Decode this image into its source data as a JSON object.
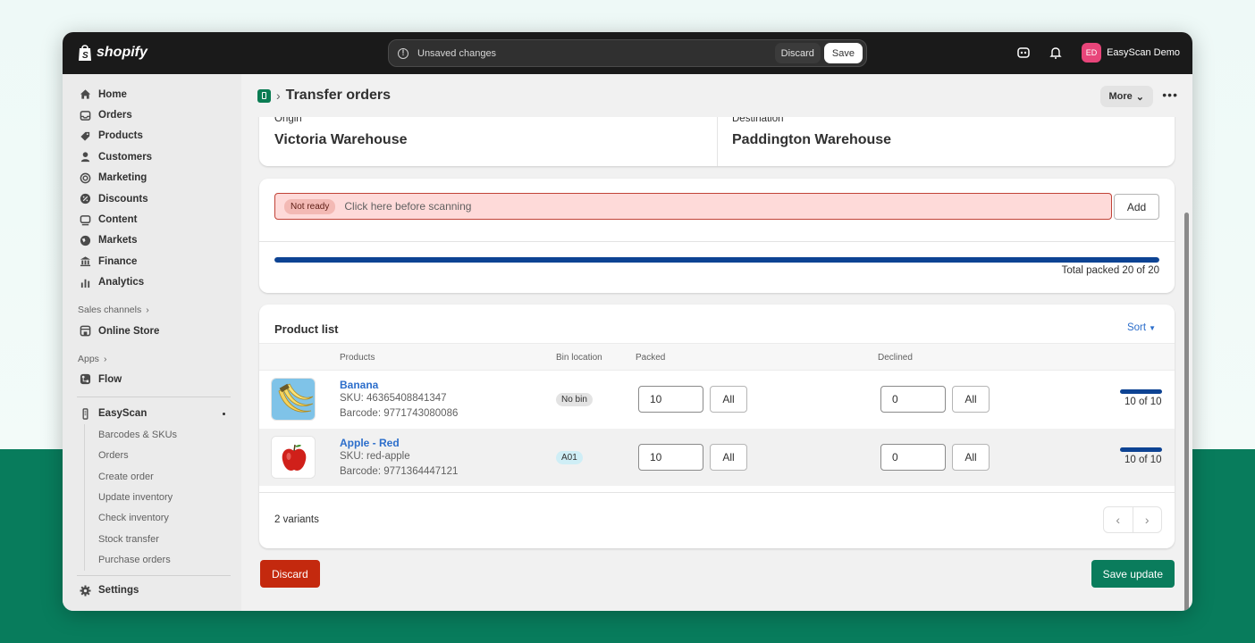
{
  "topbar": {
    "brand": "shopify",
    "unsaved_message": "Unsaved changes",
    "discard_label": "Discard",
    "save_label": "Save",
    "user_initials": "ED",
    "user_name": "EasyScan Demo"
  },
  "sidebar": {
    "items": [
      {
        "label": "Home",
        "icon": "home-icon"
      },
      {
        "label": "Orders",
        "icon": "inbox-icon"
      },
      {
        "label": "Products",
        "icon": "tag-icon"
      },
      {
        "label": "Customers",
        "icon": "person-icon"
      },
      {
        "label": "Marketing",
        "icon": "target-icon"
      },
      {
        "label": "Discounts",
        "icon": "discount-icon"
      },
      {
        "label": "Content",
        "icon": "content-icon"
      },
      {
        "label": "Markets",
        "icon": "globe-icon"
      },
      {
        "label": "Finance",
        "icon": "bank-icon"
      },
      {
        "label": "Analytics",
        "icon": "chart-icon"
      }
    ],
    "sales_channels_title": "Sales channels",
    "online_store": "Online Store",
    "apps_title": "Apps",
    "flow": "Flow",
    "easyscan": "EasyScan",
    "easyscan_sub": [
      "Barcodes & SKUs",
      "Orders",
      "Create order",
      "Update inventory",
      "Check inventory",
      "Stock transfer",
      "Purchase orders"
    ],
    "settings": "Settings"
  },
  "header": {
    "title": "Transfer orders",
    "more_label": "More",
    "more_actions": "•••"
  },
  "locations": {
    "origin_label": "Origin",
    "origin_value": "Victoria Warehouse",
    "destination_label": "Destination",
    "destination_value": "Paddington Warehouse"
  },
  "scanner": {
    "status_badge": "Not ready",
    "placeholder": "Click here before scanning",
    "add_label": "Add",
    "progress": 1.0,
    "total_text": "Total packed 20 of 20"
  },
  "product_list": {
    "title": "Product list",
    "sort_label": "Sort",
    "columns": [
      "Products",
      "Bin location",
      "Packed",
      "Declined"
    ],
    "rows": [
      {
        "name": "Banana",
        "sku": "SKU: 46365408841347",
        "barcode": "Barcode: 9771743080086",
        "bin": "No bin",
        "packed": "10",
        "declined": "0",
        "all_label": "All",
        "progress": 1.0,
        "count_text": "10 of 10"
      },
      {
        "name": "Apple - Red",
        "sku": "SKU: red-apple",
        "barcode": "Barcode: 9771364447121",
        "bin": "A01",
        "packed": "10",
        "declined": "0",
        "all_label": "All",
        "progress": 1.0,
        "count_text": "10 of 10"
      }
    ],
    "variants_text": "2 variants"
  },
  "footer": {
    "discard_label": "Discard",
    "save_label": "Save update"
  },
  "colors": {
    "primary_green": "#0a7c5c",
    "critical_red": "#c4290e",
    "progress_blue": "#0d4393",
    "link_blue": "#2c6ecb"
  }
}
